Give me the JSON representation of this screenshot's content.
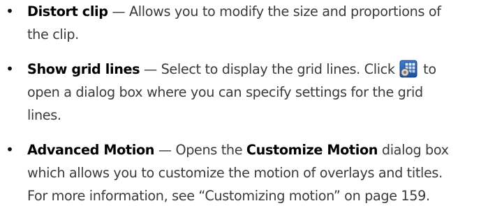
{
  "items": [
    {
      "term": "Distort clip",
      "line1": "— Allows you to modify the size and proportions of",
      "line2": "the clip."
    },
    {
      "term": "Show grid lines",
      "line1_before_icon": "— Select to display the grid lines. Click",
      "line1_after_icon": "to",
      "line2": "open a dialog box where you can specify settings for the grid",
      "line3": "lines.",
      "icon": "grid-settings-icon"
    },
    {
      "term": "Advanced Motion",
      "line1_before_bold": "— Opens the",
      "bold": "Customize Motion",
      "line1_after_bold": "dialog box",
      "line2": "which allows you to customize the motion of overlays and titles.",
      "line3": "For more information, see “Customizing motion” on page 159."
    }
  ],
  "bullet": "•"
}
